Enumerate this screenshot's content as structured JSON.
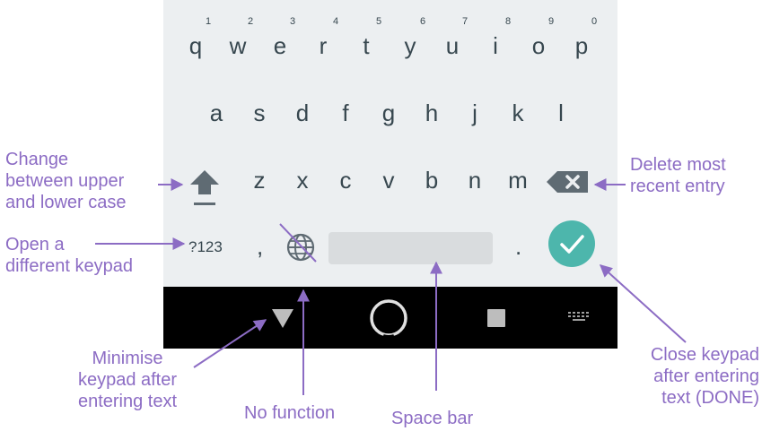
{
  "keyboard": {
    "row1": [
      {
        "key": "q",
        "hint": "1"
      },
      {
        "key": "w",
        "hint": "2"
      },
      {
        "key": "e",
        "hint": "3"
      },
      {
        "key": "r",
        "hint": "4"
      },
      {
        "key": "t",
        "hint": "5"
      },
      {
        "key": "y",
        "hint": "6"
      },
      {
        "key": "u",
        "hint": "7"
      },
      {
        "key": "i",
        "hint": "8"
      },
      {
        "key": "o",
        "hint": "9"
      },
      {
        "key": "p",
        "hint": "0"
      }
    ],
    "row2": [
      "a",
      "s",
      "d",
      "f",
      "g",
      "h",
      "j",
      "k",
      "l"
    ],
    "row3": [
      "z",
      "x",
      "c",
      "v",
      "b",
      "n",
      "m"
    ],
    "symbols_key": "?123",
    "comma_key": ",",
    "period_key": ".",
    "shift_icon": "shift-arrow-icon",
    "delete_icon": "backspace-icon",
    "language_icon": "globe-icon",
    "done_icon": "checkmark-icon",
    "colors": {
      "keyboard_bg": "#eceff1",
      "done_bg": "#4db6ac",
      "annotation": "#8c6cc4"
    }
  },
  "navbar": {
    "back_icon": "triangle-down-icon",
    "home_icon": "circle-icon",
    "recents_icon": "square-icon",
    "keyboard_icon": "keyboard-icon"
  },
  "annotations": {
    "shift": [
      "Change",
      "between upper",
      "and lower case"
    ],
    "symbols": [
      "Open a",
      "different keypad"
    ],
    "delete": [
      "Delete most",
      "recent entry"
    ],
    "minimise": [
      "Minimise",
      "keypad after",
      "entering text"
    ],
    "no_function": "No function",
    "space_bar": "Space bar",
    "done": [
      "Close keypad",
      "after entering",
      "text (DONE)"
    ]
  }
}
